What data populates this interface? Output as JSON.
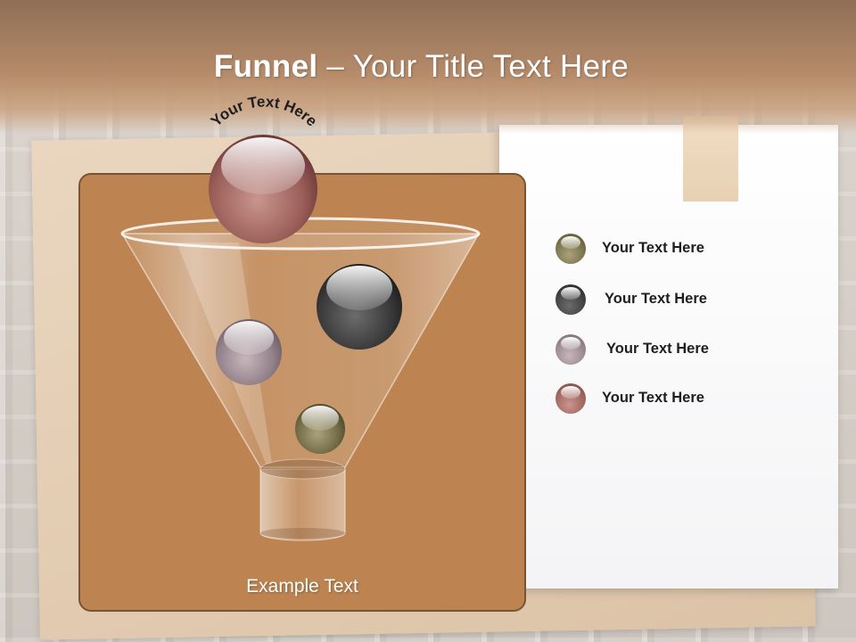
{
  "title": {
    "bold": "Funnel",
    "rest": " – Your Title Text Here"
  },
  "arc_text": "Your Text Here",
  "funnel_caption": "Example Text",
  "legend": [
    {
      "label": "Your  Text Here",
      "color": "#7a7048"
    },
    {
      "label": "Your  Text Here",
      "color": "#3c3c3c"
    },
    {
      "label": "Your  Text Here",
      "color": "#9a878c"
    },
    {
      "label": "Your  Text Here",
      "color": "#9a5a4c"
    }
  ],
  "colors": {
    "header": "#a87e5e",
    "panel": "#bd8451",
    "panel_border": "#7a5333"
  }
}
